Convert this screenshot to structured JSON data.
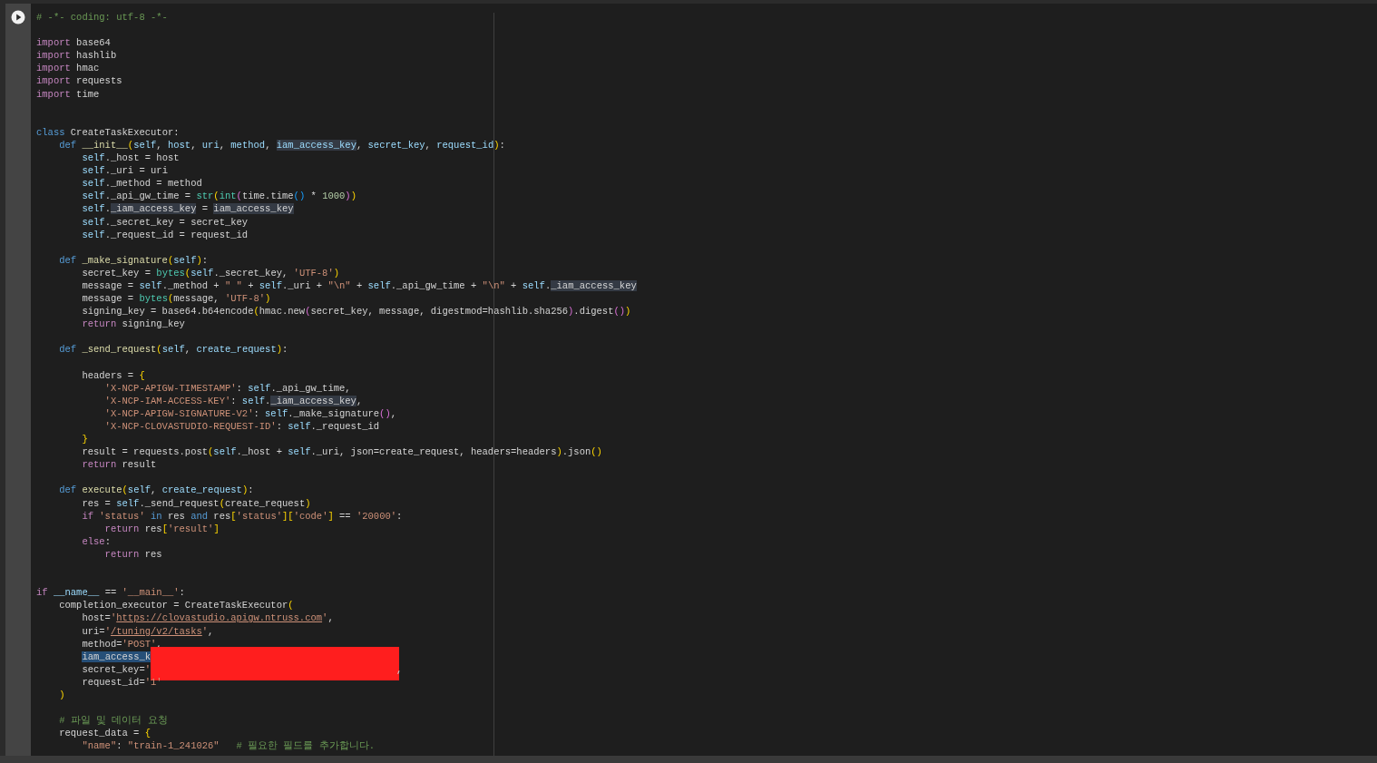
{
  "lines": [
    {
      "kind": "code",
      "tokens": [
        {
          "kind": "comment",
          "text": "# -*- coding: utf-8 -*-"
        }
      ]
    },
    {
      "kind": "blank"
    },
    {
      "kind": "code",
      "tokens": [
        {
          "kind": "keyword",
          "text": "import"
        },
        {
          "kind": "plain",
          "text": " base64"
        }
      ]
    },
    {
      "kind": "code",
      "tokens": [
        {
          "kind": "keyword",
          "text": "import"
        },
        {
          "kind": "plain",
          "text": " hashlib"
        }
      ]
    },
    {
      "kind": "code",
      "tokens": [
        {
          "kind": "keyword",
          "text": "import"
        },
        {
          "kind": "plain",
          "text": " hmac"
        }
      ]
    },
    {
      "kind": "code",
      "tokens": [
        {
          "kind": "keyword",
          "text": "import"
        },
        {
          "kind": "plain",
          "text": " requests"
        }
      ]
    },
    {
      "kind": "code",
      "tokens": [
        {
          "kind": "keyword",
          "text": "import"
        },
        {
          "kind": "plain",
          "text": " time"
        }
      ]
    },
    {
      "kind": "blank"
    },
    {
      "kind": "blank"
    },
    {
      "kind": "code",
      "tokens": [
        {
          "kind": "storage",
          "text": "class"
        },
        {
          "kind": "plain",
          "text": " CreateTaskExecutor:"
        }
      ]
    },
    {
      "kind": "code",
      "tokens": [
        {
          "kind": "storage",
          "text": "    def"
        },
        {
          "kind": "function",
          "text": " __init__"
        },
        {
          "kind": "bracket1",
          "text": "("
        },
        {
          "kind": "variable",
          "text": "self"
        },
        {
          "kind": "plain",
          "text": ", "
        },
        {
          "kind": "variable",
          "text": "host"
        },
        {
          "kind": "plain",
          "text": ", "
        },
        {
          "kind": "variable",
          "text": "uri"
        },
        {
          "kind": "plain",
          "text": ", "
        },
        {
          "kind": "variable",
          "text": "method"
        },
        {
          "kind": "plain",
          "text": ", "
        },
        {
          "kind": "variable",
          "text": "iam_access_key",
          "highlight": true
        },
        {
          "kind": "plain",
          "text": ", "
        },
        {
          "kind": "variable",
          "text": "secret_key"
        },
        {
          "kind": "plain",
          "text": ", "
        },
        {
          "kind": "variable",
          "text": "request_id"
        },
        {
          "kind": "bracket1",
          "text": ")"
        },
        {
          "kind": "plain",
          "text": ":"
        }
      ]
    },
    {
      "kind": "code",
      "tokens": [
        {
          "kind": "variable",
          "text": "        self"
        },
        {
          "kind": "plain",
          "text": "._host = host"
        }
      ]
    },
    {
      "kind": "code",
      "tokens": [
        {
          "kind": "variable",
          "text": "        self"
        },
        {
          "kind": "plain",
          "text": "._uri = uri"
        }
      ]
    },
    {
      "kind": "code",
      "tokens": [
        {
          "kind": "variable",
          "text": "        self"
        },
        {
          "kind": "plain",
          "text": "._method = method"
        }
      ]
    },
    {
      "kind": "code",
      "tokens": [
        {
          "kind": "variable",
          "text": "        self"
        },
        {
          "kind": "plain",
          "text": "._api_gw_time = "
        },
        {
          "kind": "builtin",
          "text": "str"
        },
        {
          "kind": "bracket1",
          "text": "("
        },
        {
          "kind": "builtin",
          "text": "int"
        },
        {
          "kind": "bracket2",
          "text": "("
        },
        {
          "kind": "plain",
          "text": "time.time"
        },
        {
          "kind": "bracket3",
          "text": "()"
        },
        {
          "kind": "plain",
          "text": " * "
        },
        {
          "kind": "number",
          "text": "1000"
        },
        {
          "kind": "bracket2",
          "text": ")"
        },
        {
          "kind": "bracket1",
          "text": ")"
        }
      ]
    },
    {
      "kind": "code",
      "tokens": [
        {
          "kind": "variable",
          "text": "        self"
        },
        {
          "kind": "plain",
          "text": "."
        },
        {
          "kind": "plain",
          "text": "_iam_access_key",
          "highlight": true
        },
        {
          "kind": "plain",
          "text": " = "
        },
        {
          "kind": "plain",
          "text": "iam_access_key",
          "highlight": true
        }
      ]
    },
    {
      "kind": "code",
      "tokens": [
        {
          "kind": "variable",
          "text": "        self"
        },
        {
          "kind": "plain",
          "text": "._secret_key = secret_key"
        }
      ]
    },
    {
      "kind": "code",
      "tokens": [
        {
          "kind": "variable",
          "text": "        self"
        },
        {
          "kind": "plain",
          "text": "._request_id = request_id"
        }
      ]
    },
    {
      "kind": "blank"
    },
    {
      "kind": "code",
      "tokens": [
        {
          "kind": "storage",
          "text": "    def"
        },
        {
          "kind": "function",
          "text": " _make_signature"
        },
        {
          "kind": "bracket1",
          "text": "("
        },
        {
          "kind": "variable",
          "text": "self"
        },
        {
          "kind": "bracket1",
          "text": ")"
        },
        {
          "kind": "plain",
          "text": ":"
        }
      ]
    },
    {
      "kind": "code",
      "tokens": [
        {
          "kind": "plain",
          "text": "        secret_key = "
        },
        {
          "kind": "builtin",
          "text": "bytes"
        },
        {
          "kind": "bracket1",
          "text": "("
        },
        {
          "kind": "variable",
          "text": "self"
        },
        {
          "kind": "plain",
          "text": "._secret_key, "
        },
        {
          "kind": "string",
          "text": "'UTF-8'"
        },
        {
          "kind": "bracket1",
          "text": ")"
        }
      ]
    },
    {
      "kind": "code",
      "tokens": [
        {
          "kind": "plain",
          "text": "        message = "
        },
        {
          "kind": "variable",
          "text": "self"
        },
        {
          "kind": "plain",
          "text": "._method + "
        },
        {
          "kind": "string",
          "text": "\" \""
        },
        {
          "kind": "plain",
          "text": " + "
        },
        {
          "kind": "variable",
          "text": "self"
        },
        {
          "kind": "plain",
          "text": "._uri + "
        },
        {
          "kind": "string",
          "text": "\"\\n\""
        },
        {
          "kind": "plain",
          "text": " + "
        },
        {
          "kind": "variable",
          "text": "self"
        },
        {
          "kind": "plain",
          "text": "._api_gw_time + "
        },
        {
          "kind": "string",
          "text": "\"\\n\""
        },
        {
          "kind": "plain",
          "text": " + "
        },
        {
          "kind": "variable",
          "text": "self"
        },
        {
          "kind": "plain",
          "text": "."
        },
        {
          "kind": "plain",
          "text": "_iam_access_key",
          "highlight": true
        }
      ]
    },
    {
      "kind": "code",
      "tokens": [
        {
          "kind": "plain",
          "text": "        message = "
        },
        {
          "kind": "builtin",
          "text": "bytes"
        },
        {
          "kind": "bracket1",
          "text": "("
        },
        {
          "kind": "plain",
          "text": "message, "
        },
        {
          "kind": "string",
          "text": "'UTF-8'"
        },
        {
          "kind": "bracket1",
          "text": ")"
        }
      ]
    },
    {
      "kind": "code",
      "tokens": [
        {
          "kind": "plain",
          "text": "        signing_key = base64.b64encode"
        },
        {
          "kind": "bracket1",
          "text": "("
        },
        {
          "kind": "plain",
          "text": "hmac.new"
        },
        {
          "kind": "bracket2",
          "text": "("
        },
        {
          "kind": "plain",
          "text": "secret_key, message, digestmod=hashlib.sha256"
        },
        {
          "kind": "bracket2",
          "text": ")"
        },
        {
          "kind": "plain",
          "text": ".digest"
        },
        {
          "kind": "bracket2",
          "text": "()"
        },
        {
          "kind": "bracket1",
          "text": ")"
        }
      ]
    },
    {
      "kind": "code",
      "tokens": [
        {
          "kind": "keyword",
          "text": "        return"
        },
        {
          "kind": "plain",
          "text": " signing_key"
        }
      ]
    },
    {
      "kind": "blank"
    },
    {
      "kind": "code",
      "tokens": [
        {
          "kind": "storage",
          "text": "    def"
        },
        {
          "kind": "function",
          "text": " _send_request"
        },
        {
          "kind": "bracket1",
          "text": "("
        },
        {
          "kind": "variable",
          "text": "self"
        },
        {
          "kind": "plain",
          "text": ", "
        },
        {
          "kind": "variable",
          "text": "create_request"
        },
        {
          "kind": "bracket1",
          "text": ")"
        },
        {
          "kind": "plain",
          "text": ":"
        }
      ]
    },
    {
      "kind": "blank"
    },
    {
      "kind": "code",
      "tokens": [
        {
          "kind": "plain",
          "text": "        headers = "
        },
        {
          "kind": "bracket1",
          "text": "{"
        }
      ]
    },
    {
      "kind": "code",
      "tokens": [
        {
          "kind": "string",
          "text": "            'X-NCP-APIGW-TIMESTAMP'"
        },
        {
          "kind": "plain",
          "text": ": "
        },
        {
          "kind": "variable",
          "text": "self"
        },
        {
          "kind": "plain",
          "text": "._api_gw_time,"
        }
      ]
    },
    {
      "kind": "code",
      "tokens": [
        {
          "kind": "string",
          "text": "            'X-NCP-IAM-ACCESS-KEY'"
        },
        {
          "kind": "plain",
          "text": ": "
        },
        {
          "kind": "variable",
          "text": "self"
        },
        {
          "kind": "plain",
          "text": "."
        },
        {
          "kind": "plain",
          "text": "_iam_access_key",
          "highlight": true
        },
        {
          "kind": "plain",
          "text": ","
        }
      ]
    },
    {
      "kind": "code",
      "tokens": [
        {
          "kind": "string",
          "text": "            'X-NCP-APIGW-SIGNATURE-V2'"
        },
        {
          "kind": "plain",
          "text": ": "
        },
        {
          "kind": "variable",
          "text": "self"
        },
        {
          "kind": "plain",
          "text": "._make_signature"
        },
        {
          "kind": "bracket2",
          "text": "()"
        },
        {
          "kind": "plain",
          "text": ","
        }
      ]
    },
    {
      "kind": "code",
      "tokens": [
        {
          "kind": "string",
          "text": "            'X-NCP-CLOVASTUDIO-REQUEST-ID'"
        },
        {
          "kind": "plain",
          "text": ": "
        },
        {
          "kind": "variable",
          "text": "self"
        },
        {
          "kind": "plain",
          "text": "._request_id"
        }
      ]
    },
    {
      "kind": "code",
      "tokens": [
        {
          "kind": "bracket1",
          "text": "        }"
        }
      ]
    },
    {
      "kind": "code",
      "tokens": [
        {
          "kind": "plain",
          "text": "        result = requests.post"
        },
        {
          "kind": "bracket1",
          "text": "("
        },
        {
          "kind": "variable",
          "text": "self"
        },
        {
          "kind": "plain",
          "text": "._host + "
        },
        {
          "kind": "variable",
          "text": "self"
        },
        {
          "kind": "plain",
          "text": "._uri, json=create_request, headers=headers"
        },
        {
          "kind": "bracket1",
          "text": ")"
        },
        {
          "kind": "plain",
          "text": ".json"
        },
        {
          "kind": "bracket1",
          "text": "()"
        }
      ]
    },
    {
      "kind": "code",
      "tokens": [
        {
          "kind": "keyword",
          "text": "        return"
        },
        {
          "kind": "plain",
          "text": " result"
        }
      ]
    },
    {
      "kind": "blank"
    },
    {
      "kind": "code",
      "tokens": [
        {
          "kind": "storage",
          "text": "    def"
        },
        {
          "kind": "function",
          "text": " execute"
        },
        {
          "kind": "bracket1",
          "text": "("
        },
        {
          "kind": "variable",
          "text": "self"
        },
        {
          "kind": "plain",
          "text": ", "
        },
        {
          "kind": "variable",
          "text": "create_request"
        },
        {
          "kind": "bracket1",
          "text": ")"
        },
        {
          "kind": "plain",
          "text": ":"
        }
      ]
    },
    {
      "kind": "code",
      "tokens": [
        {
          "kind": "plain",
          "text": "        res = "
        },
        {
          "kind": "variable",
          "text": "self"
        },
        {
          "kind": "plain",
          "text": "._send_request"
        },
        {
          "kind": "bracket1",
          "text": "("
        },
        {
          "kind": "plain",
          "text": "create_request"
        },
        {
          "kind": "bracket1",
          "text": ")"
        }
      ]
    },
    {
      "kind": "code",
      "tokens": [
        {
          "kind": "keyword",
          "text": "        if"
        },
        {
          "kind": "string",
          "text": " 'status'"
        },
        {
          "kind": "storage",
          "text": " in"
        },
        {
          "kind": "plain",
          "text": " res "
        },
        {
          "kind": "storage",
          "text": "and"
        },
        {
          "kind": "plain",
          "text": " res"
        },
        {
          "kind": "bracket1",
          "text": "["
        },
        {
          "kind": "string",
          "text": "'status'"
        },
        {
          "kind": "bracket1",
          "text": "]["
        },
        {
          "kind": "string",
          "text": "'code'"
        },
        {
          "kind": "bracket1",
          "text": "]"
        },
        {
          "kind": "plain",
          "text": " == "
        },
        {
          "kind": "string",
          "text": "'20000'"
        },
        {
          "kind": "plain",
          "text": ":"
        }
      ]
    },
    {
      "kind": "code",
      "tokens": [
        {
          "kind": "keyword",
          "text": "            return"
        },
        {
          "kind": "plain",
          "text": " res"
        },
        {
          "kind": "bracket1",
          "text": "["
        },
        {
          "kind": "string",
          "text": "'result'"
        },
        {
          "kind": "bracket1",
          "text": "]"
        }
      ]
    },
    {
      "kind": "code",
      "tokens": [
        {
          "kind": "keyword",
          "text": "        else"
        },
        {
          "kind": "plain",
          "text": ":"
        }
      ]
    },
    {
      "kind": "code",
      "tokens": [
        {
          "kind": "keyword",
          "text": "            return"
        },
        {
          "kind": "plain",
          "text": " res"
        }
      ]
    },
    {
      "kind": "blank"
    },
    {
      "kind": "blank"
    },
    {
      "kind": "code",
      "tokens": [
        {
          "kind": "keyword",
          "text": "if"
        },
        {
          "kind": "variable",
          "text": " __name__"
        },
        {
          "kind": "plain",
          "text": " == "
        },
        {
          "kind": "string",
          "text": "'__main__'"
        },
        {
          "kind": "plain",
          "text": ":"
        }
      ]
    },
    {
      "kind": "code",
      "tokens": [
        {
          "kind": "plain",
          "text": "    completion_executor = CreateTaskExecutor"
        },
        {
          "kind": "bracket1",
          "text": "("
        }
      ]
    },
    {
      "kind": "code",
      "tokens": [
        {
          "kind": "plain",
          "text": "        host="
        },
        {
          "kind": "string",
          "text": "'"
        },
        {
          "kind": "string",
          "text": "https://clovastudio.apigw.ntruss.com",
          "underlined": true
        },
        {
          "kind": "string",
          "text": "'"
        },
        {
          "kind": "plain",
          "text": ","
        }
      ]
    },
    {
      "kind": "code",
      "tokens": [
        {
          "kind": "plain",
          "text": "        uri="
        },
        {
          "kind": "string",
          "text": "'"
        },
        {
          "kind": "string",
          "text": "/tuning/v2/tasks",
          "underlined": true
        },
        {
          "kind": "string",
          "text": "'"
        },
        {
          "kind": "plain",
          "text": ","
        }
      ]
    },
    {
      "kind": "code",
      "tokens": [
        {
          "kind": "plain",
          "text": "        method="
        },
        {
          "kind": "string",
          "text": "'POST'"
        },
        {
          "kind": "plain",
          "text": ","
        }
      ]
    },
    {
      "kind": "code",
      "redacted": true,
      "tokens": [
        {
          "kind": "plain",
          "text": "        iam_access_k",
          "selected": true
        }
      ]
    },
    {
      "kind": "code",
      "tokens": [
        {
          "kind": "plain",
          "text": "        secret_key="
        },
        {
          "kind": "string",
          "text": "'"
        },
        {
          "kind": "plain",
          "text": "                                           ,"
        }
      ]
    },
    {
      "kind": "code",
      "tokens": [
        {
          "kind": "plain",
          "text": "        request_id="
        },
        {
          "kind": "string",
          "text": "'1'"
        }
      ]
    },
    {
      "kind": "code",
      "tokens": [
        {
          "kind": "bracket1",
          "text": "    )"
        }
      ]
    },
    {
      "kind": "blank"
    },
    {
      "kind": "code",
      "tokens": [
        {
          "kind": "comment",
          "text": "    # 파일 및 데이터 요청"
        }
      ]
    },
    {
      "kind": "code",
      "tokens": [
        {
          "kind": "plain",
          "text": "    request_data = "
        },
        {
          "kind": "bracket1",
          "text": "{"
        }
      ]
    },
    {
      "kind": "code",
      "tokens": [
        {
          "kind": "string",
          "text": "        \"name\""
        },
        {
          "kind": "plain",
          "text": ": "
        },
        {
          "kind": "string",
          "text": "\"train-1_241026\""
        },
        {
          "kind": "comment",
          "text": "   # 필요한 필드를 추가합니다."
        }
      ]
    }
  ]
}
